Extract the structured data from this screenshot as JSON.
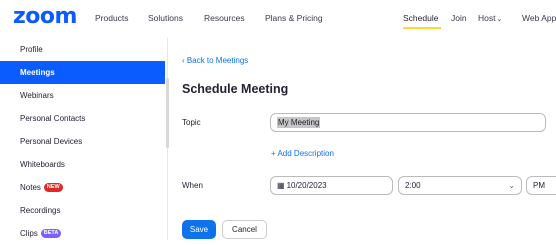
{
  "brand": {
    "logo_text": "zoom",
    "accent": "#0b5cff",
    "link_color": "#0e72ed"
  },
  "topnav": {
    "items": [
      "Products",
      "Solutions",
      "Resources",
      "Plans & Pricing"
    ],
    "right_items": [
      "Schedule",
      "Join",
      "Host",
      "Web App"
    ],
    "active": "Schedule"
  },
  "sidebar": {
    "items": [
      {
        "label": "Profile"
      },
      {
        "label": "Meetings",
        "active": true
      },
      {
        "label": "Webinars"
      },
      {
        "label": "Personal Contacts"
      },
      {
        "label": "Personal Devices"
      },
      {
        "label": "Whiteboards"
      },
      {
        "label": "Notes",
        "badge": "NEW"
      },
      {
        "label": "Recordings"
      },
      {
        "label": "Clips",
        "badge": "BETA"
      }
    ]
  },
  "main": {
    "back_link": "Back to Meetings",
    "title": "Schedule Meeting",
    "topic_label": "Topic",
    "topic_value": "My Meeting",
    "add_description": "+ Add Description",
    "when_label": "When",
    "date_value": "10/20/2023",
    "time_value": "2:00",
    "ampm_value": "PM",
    "save_label": "Save",
    "cancel_label": "Cancel"
  }
}
